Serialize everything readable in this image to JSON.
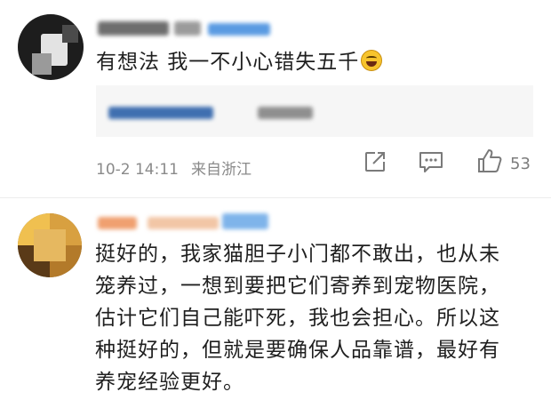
{
  "comments": [
    {
      "text": "有想法 我一不小心错失五千",
      "emoji": "laugh-cry-emoji",
      "time": "10-2 14:11",
      "location": "来自浙江",
      "likes": "53"
    },
    {
      "lines": [
        "挺好的，我家猫胆子小门都不敢出，也从未",
        "笼养过，一想到要把它们寄养到宠物医院，",
        "估计它们自己能吓死，我也会担心。所以这",
        "种挺好的，但就是要确保人品靠谱，最好有",
        "养宠经验更好。"
      ]
    }
  ],
  "colors": {
    "meta_text": "#8a8a8a",
    "body_text": "#1f1f1f",
    "quote_bg": "#f6f6f6"
  }
}
